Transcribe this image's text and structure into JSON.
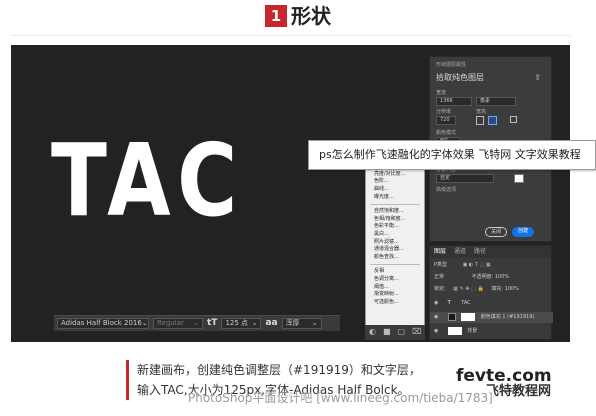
{
  "header": {
    "step_number": "1",
    "title": "形状"
  },
  "canvas": {
    "text": "TAC"
  },
  "char_bar": {
    "font_family": "Adidas Half Block 2016",
    "font_style": "Regular",
    "size_icon": "tT",
    "font_size": "125 点",
    "antialias_icon": "aa",
    "antialias": "浑厚"
  },
  "adjustment_menu": {
    "group1": [
      "纯色...",
      "渐变...",
      "图案..."
    ],
    "group2": [
      "亮度/对比度...",
      "色阶...",
      "曲线...",
      "曝光度..."
    ],
    "group3": [
      "自然饱和度...",
      "色相/饱和度...",
      "色彩平衡...",
      "黑白...",
      "照片滤镜...",
      "通道混合器...",
      "颜色查找..."
    ],
    "group4": [
      "反相",
      "色调分离...",
      "阈值...",
      "渐变映射...",
      "可选颜色..."
    ]
  },
  "properties_panel": {
    "section": "形状图层属性",
    "title": "拾取纯色图层",
    "w_label": "宽度",
    "w_value": "1366",
    "unit": "像素",
    "x_label": "分辨率",
    "x_value": "720",
    "h_label": "宽高",
    "opacity_label": "颜色模式",
    "mode_value": "8位",
    "bg_label": "背景内容",
    "bg_value": "自定",
    "preset_label": "高级选项",
    "close_button": "关闭",
    "create_button": "创建"
  },
  "layers_panel": {
    "tabs": [
      "图层",
      "通道",
      "路径"
    ],
    "kind_filter": "P类型",
    "blend_mode": "正常",
    "opacity": "不透明度: 100%",
    "lock_label": "锁定:",
    "fill": "填充: 100%",
    "layers": [
      {
        "type": "T",
        "name": "TAC"
      },
      {
        "type": "fill",
        "name": "颜色填充 1 (#191919)"
      },
      {
        "type": "bg",
        "name": "背景"
      }
    ]
  },
  "tooltip": {
    "text": "ps怎么制作飞速融化的字体效果 飞特网 文字效果教程"
  },
  "caption": {
    "line1": "新建画布，创建纯色调整层（#191919）和文字层，",
    "line2": "输入TAC,大小为125px,字体-Adidas Half Bolck。"
  },
  "logo": {
    "brand": "fevte.com",
    "sub": "飞特教程网"
  },
  "watermark": {
    "text": "PhotoShop平面设计吧 [www.lineeg.com/tieba/1783]"
  },
  "colors": {
    "accent": "#c8262e",
    "canvas_bg": "#222222",
    "text_white": "#ffffff",
    "ps_blue": "#1473e6"
  }
}
